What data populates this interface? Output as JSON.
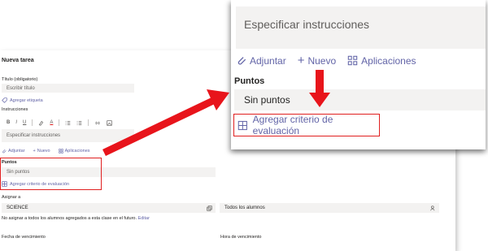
{
  "form": {
    "title": "Nueva tarea",
    "title_label": "Título (obligatorio)",
    "title_placeholder": "Escribir título",
    "add_tag": "Agregar etiqueta",
    "instructions_label": "Instrucciones",
    "instructions_placeholder": "Especificar instrucciones",
    "toolbar": {
      "bold": "B",
      "italic": "I",
      "underline": "U",
      "font_color": "A"
    },
    "attach": "Adjuntar",
    "new": "Nuevo",
    "apps": "Aplicaciones",
    "points_label": "Puntos",
    "points_value": "Sin puntos",
    "add_rubric": "Agregar criterio de evaluación",
    "assign_label": "Asignar a",
    "class_value": "SCIENCE",
    "students_value": "Todos los alumnos",
    "assign_note": "No asignar a todos los alumnos agregados a esta clase en el futuro.",
    "assign_edit": "Editar",
    "due_date_label": "Fecha de vencimiento",
    "due_time_label": "Hora de vencimiento"
  },
  "zoom": {
    "instructions_placeholder": "Especificar instrucciones",
    "attach": "Adjuntar",
    "new": "Nuevo",
    "apps": "Aplicaciones",
    "points_label": "Puntos",
    "points_value": "Sin puntos",
    "add_rubric": "Agregar criterio de evaluación"
  },
  "colors": {
    "accent": "#6264a7",
    "highlight": "#e02020",
    "field_bg": "#f3f2f1"
  }
}
